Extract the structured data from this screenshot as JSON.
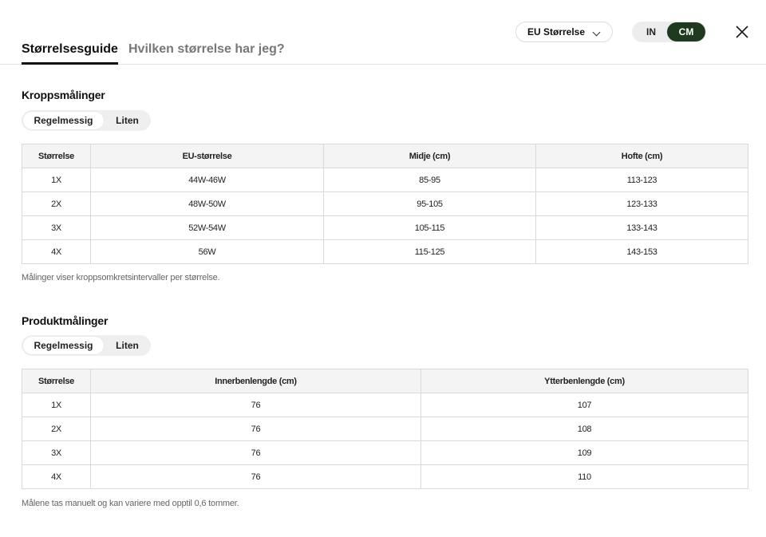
{
  "header": {
    "tabs": [
      {
        "label": "Størrelsesguide",
        "active": true
      },
      {
        "label": "Hvilken størrelse har jeg?",
        "active": false
      }
    ],
    "size_select": {
      "value": "EU Størrelse",
      "icon": "chevron-down-icon"
    },
    "unit_toggle": {
      "options": [
        "IN",
        "CM"
      ],
      "selected": "CM"
    },
    "close_icon": "close-icon"
  },
  "body_section": {
    "title": "Kroppsmålinger",
    "fit_toggle": {
      "options": [
        "Regelmessig",
        "Liten"
      ],
      "selected": "Regelmessig"
    },
    "headers": [
      "Størrelse",
      "EU-størrelse",
      "Midje (cm)",
      "Hofte (cm)"
    ],
    "rows": [
      [
        "1X",
        "44W-46W",
        "85-95",
        "113-123"
      ],
      [
        "2X",
        "48W-50W",
        "95-105",
        "123-133"
      ],
      [
        "3X",
        "52W-54W",
        "105-115",
        "133-143"
      ],
      [
        "4X",
        "56W",
        "115-125",
        "143-153"
      ]
    ],
    "note": "Målinger viser kroppsomkretsintervaller per størrelse."
  },
  "product_section": {
    "title": "Produktmålinger",
    "fit_toggle": {
      "options": [
        "Regelmessig",
        "Liten"
      ],
      "selected": "Regelmessig"
    },
    "headers": [
      "Størrelse",
      "Innerbenlengde (cm)",
      "Ytterbenlengde (cm)"
    ],
    "rows": [
      [
        "1X",
        "76",
        "107"
      ],
      [
        "2X",
        "76",
        "108"
      ],
      [
        "3X",
        "76",
        "109"
      ],
      [
        "4X",
        "76",
        "110"
      ]
    ],
    "note": "Målene tas manuelt og kan variere med opptil 0,6 tommer."
  },
  "colors": {
    "accent": "#1f3a1f",
    "border": "#d9d9d9",
    "header_bg": "#f4f4f4"
  }
}
